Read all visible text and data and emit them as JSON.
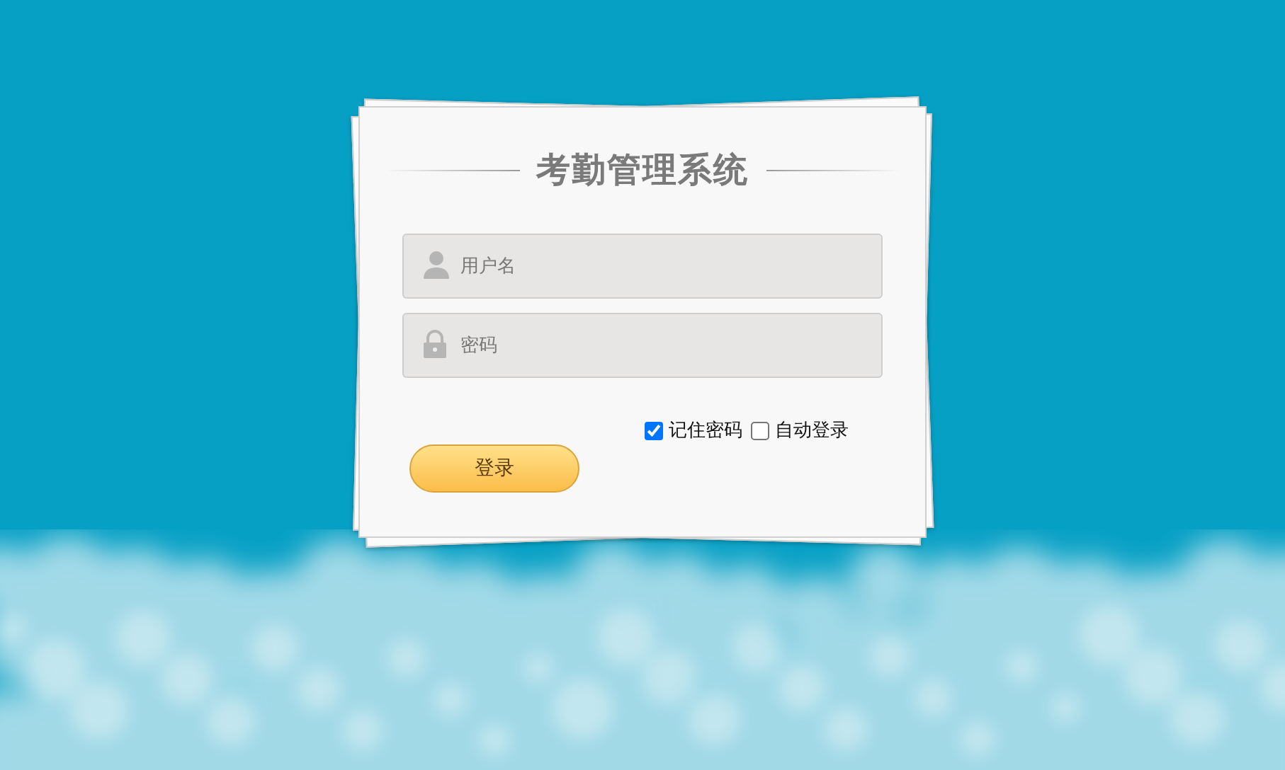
{
  "title": "考勤管理系统",
  "fields": [
    {
      "kind": "user",
      "placeholder": "用户名"
    },
    {
      "kind": "lock",
      "placeholder": "密码"
    }
  ],
  "options": [
    {
      "label": "记住密码",
      "checked": true
    },
    {
      "label": "自动登录",
      "checked": false
    }
  ],
  "login_button": "登录"
}
